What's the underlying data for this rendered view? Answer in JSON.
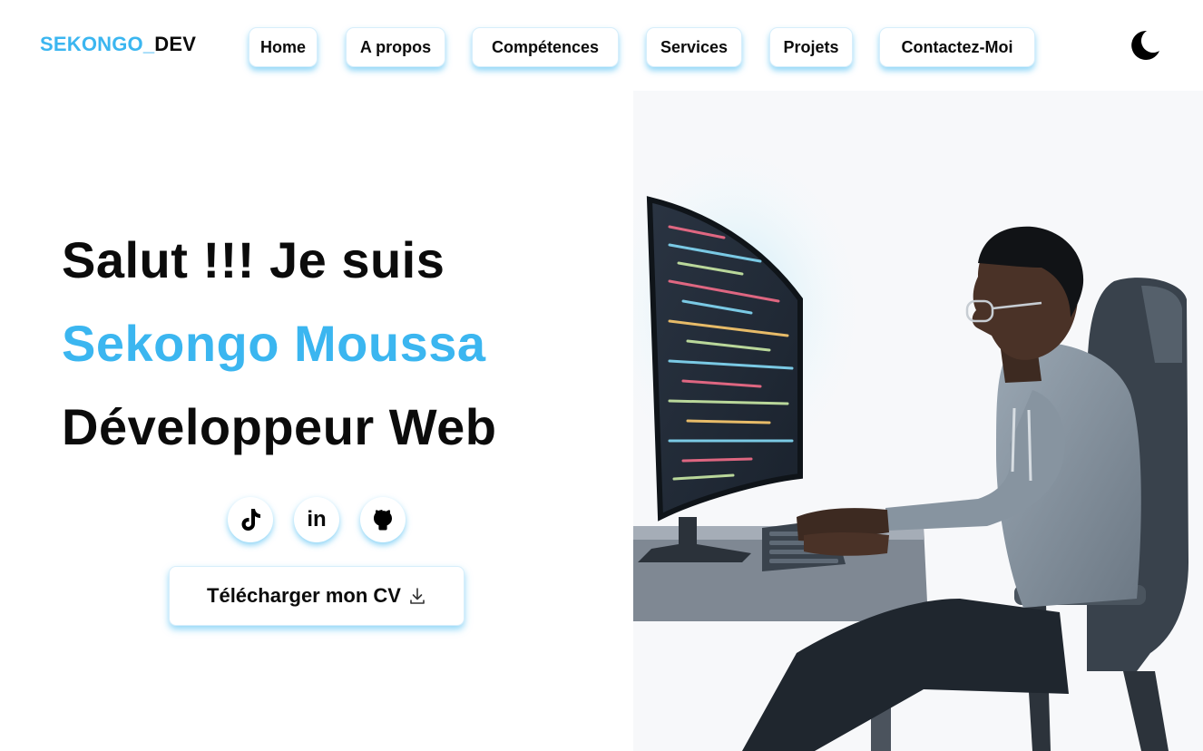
{
  "header": {
    "logo_part1": "SEKONGO_",
    "logo_part2": "DEV",
    "nav": [
      {
        "label": "Home"
      },
      {
        "label": "A propos"
      },
      {
        "label": "Compétences"
      },
      {
        "label": "Services"
      },
      {
        "label": "Projets"
      },
      {
        "label": "Contactez-Moi"
      }
    ],
    "theme_icon": "moon-icon"
  },
  "hero": {
    "line1": "Salut !!! Je suis",
    "name": "Sekongo Moussa",
    "role": "Développeur Web",
    "socials": [
      {
        "icon": "tiktok-icon"
      },
      {
        "icon": "linkedin-icon",
        "text": "in"
      },
      {
        "icon": "github-icon"
      }
    ],
    "cv_label": "Télécharger mon CV",
    "cv_icon": "download-icon"
  },
  "colors": {
    "accent": "#3bb6f0",
    "text": "#0b0b0b",
    "background": "#ffffff"
  }
}
